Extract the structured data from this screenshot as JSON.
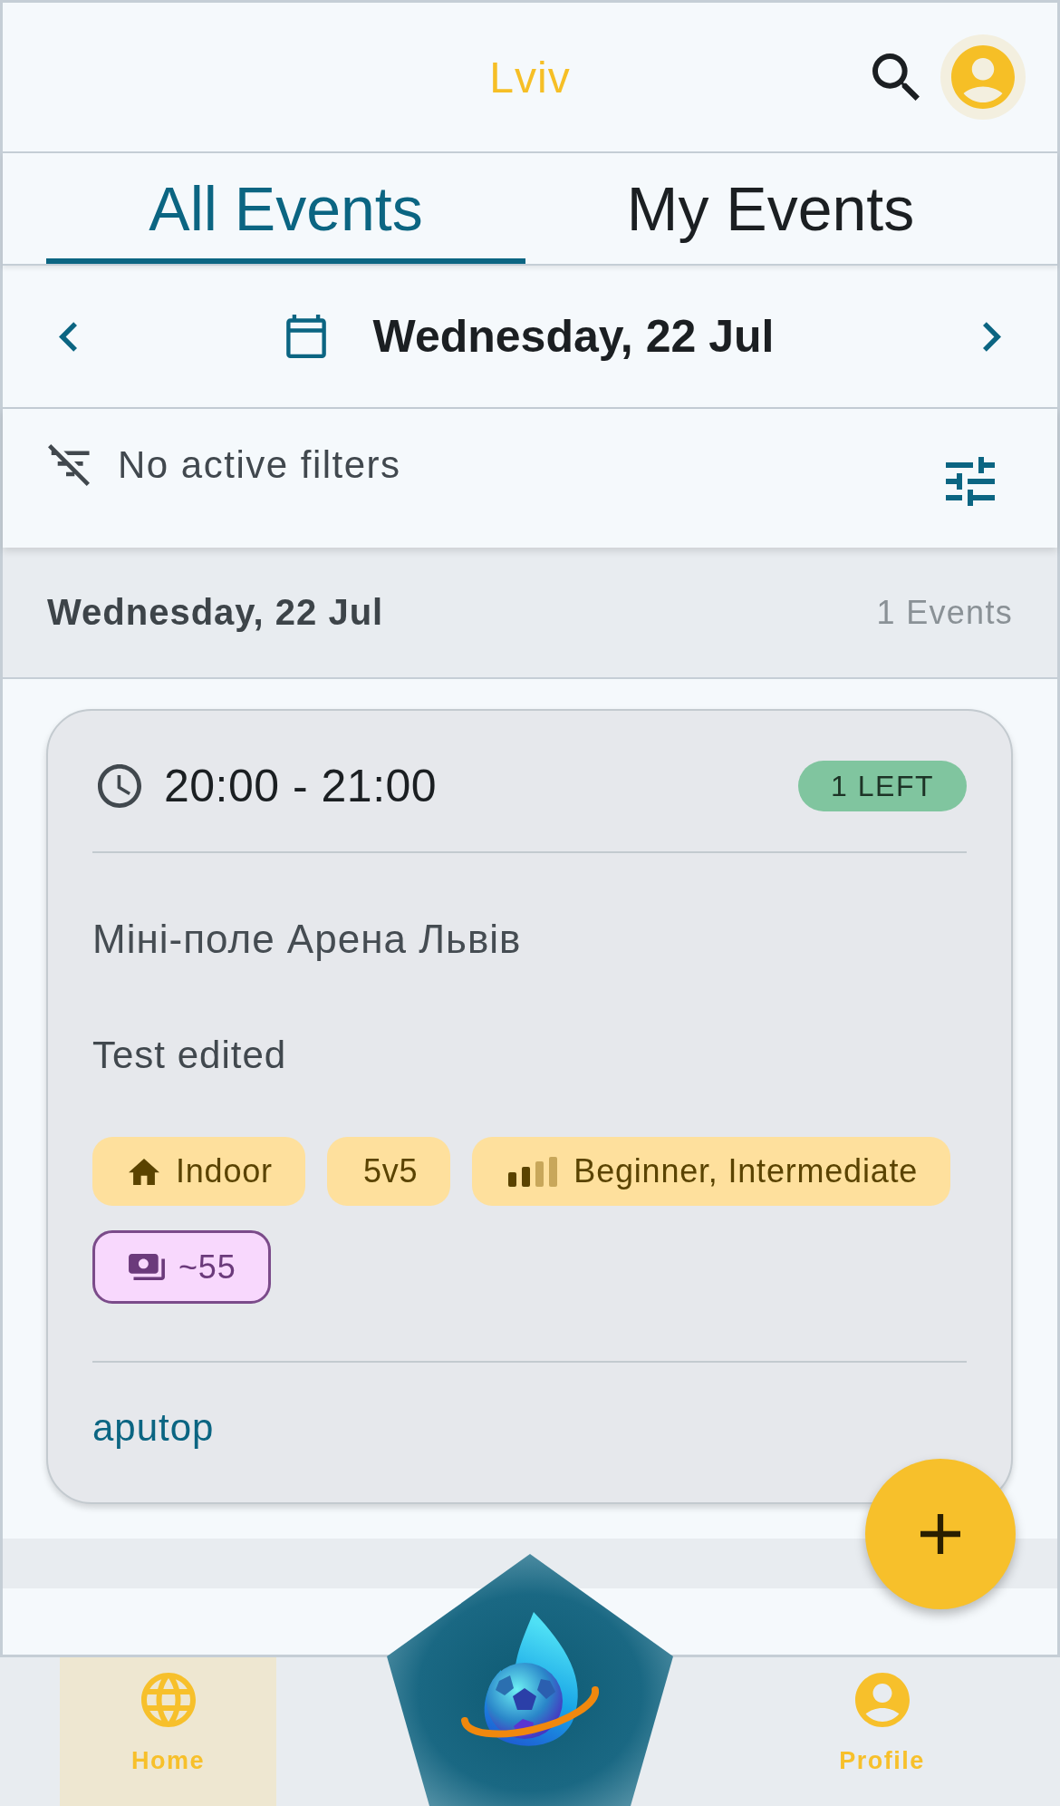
{
  "header": {
    "title": "Lviv"
  },
  "tabs": [
    {
      "label": "All Events",
      "selected": true
    },
    {
      "label": "My Events",
      "selected": false
    }
  ],
  "date_nav": {
    "date": "Wednesday, 22 Jul"
  },
  "filters": {
    "status": "No active filters"
  },
  "day_groups": [
    {
      "date": "Wednesday, 22 Jul",
      "count": "1 Events",
      "events": [
        {
          "time": "20:00 - 21:00",
          "spots": "1 LEFT",
          "venue": "Міні-поле Арена Львів",
          "description": "Test edited",
          "tags": [
            {
              "kind": "setting",
              "label": "Indoor"
            },
            {
              "kind": "format",
              "label": "5v5"
            },
            {
              "kind": "level",
              "label": "Beginner, Intermediate"
            },
            {
              "kind": "price",
              "label": "~55"
            }
          ],
          "organizer": "aputop"
        }
      ]
    }
  ],
  "bottom_nav": [
    {
      "kind": "home",
      "label": "Home",
      "selected": true
    },
    {
      "kind": "profile",
      "label": "Profile",
      "selected": false
    }
  ]
}
